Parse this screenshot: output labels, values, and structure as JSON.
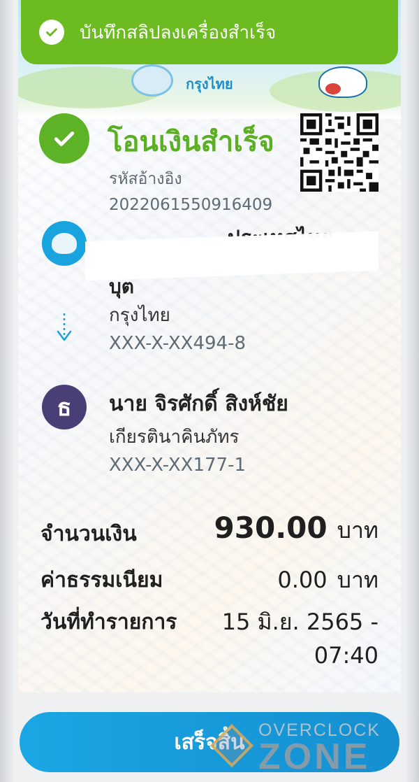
{
  "toast": {
    "message": "บันทึกสลิปลงเครื่องสำเร็จ"
  },
  "banner": {
    "brand_text": "กรุงไทย"
  },
  "status": {
    "title": "โอนเงินสำเร็จ",
    "ref_label": "รหัสอ้างอิง",
    "ref_value": "2022061550916409"
  },
  "sender": {
    "name_partial": "ประเทศไทย",
    "name_suffix": "บุต",
    "bank": "กรุงไทย",
    "account": "XXX-X-XX494-8"
  },
  "receiver": {
    "logo_glyph": "ธ",
    "name": "นาย จิรศักดิ์ สิงห์ชัย",
    "bank": "เกียรตินาคินภัทร",
    "account": "XXX-X-XX177-1"
  },
  "summary": {
    "amount_label": "จำนวนเงิน",
    "amount_value": "930.00",
    "amount_unit": "บาท",
    "fee_label": "ค่าธรรมเนียม",
    "fee_value": "0.00",
    "fee_unit": "บาท",
    "date_label": "วันที่ทำรายการ",
    "date_value": "15 มิ.ย. 2565 -",
    "time_value": "07:40"
  },
  "actions": {
    "done_label": "เสร็จสิ้น"
  },
  "watermark": {
    "line1": "OVERCLOCK",
    "line2": "ZONE"
  },
  "colors": {
    "success_green": "#5db325",
    "toast_green": "#6cbb20",
    "ktb_blue": "#19a3df",
    "bbl_purple": "#4a3e77",
    "button_blue": "#1aa6e4"
  }
}
